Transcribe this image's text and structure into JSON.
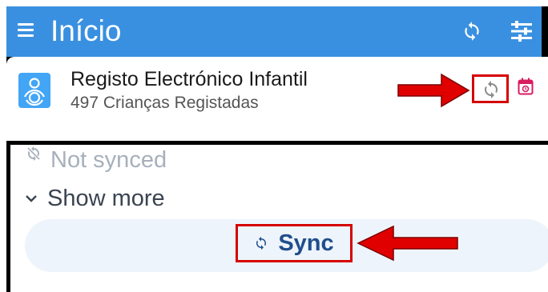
{
  "app_bar": {
    "title": "Início",
    "menu_icon": "hamburger-menu-icon",
    "sync_icon": "sync-icon",
    "settings_icon": "filter-settings-icon",
    "color": "#3a90e0"
  },
  "program_card": {
    "name": "Registo Electrónico Infantil",
    "count_text": "497 Crianças Registadas",
    "icon": "baby-program-icon",
    "sync_icon": "sync-icon",
    "calendar_icon": "calendar-icon",
    "accent": "#d81b60"
  },
  "sync_panel": {
    "status_label": "Not synced",
    "status_icon": "sync-disabled-icon",
    "show_more_label": "Show more",
    "sync_button_label": "Sync",
    "sync_button_color": "#1f4e8c"
  },
  "annotations": {
    "highlight_color": "#d50000"
  }
}
